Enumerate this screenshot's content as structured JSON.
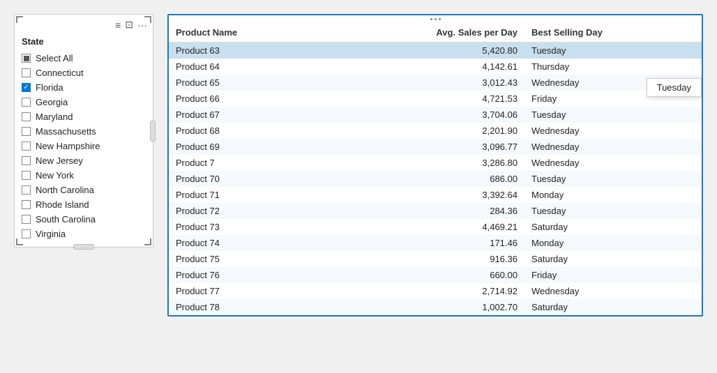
{
  "leftPanel": {
    "title": "State",
    "selectAllLabel": "Select All",
    "items": [
      {
        "label": "Connecticut",
        "checked": false
      },
      {
        "label": "Florida",
        "checked": true
      },
      {
        "label": "Georgia",
        "checked": false
      },
      {
        "label": "Maryland",
        "checked": false
      },
      {
        "label": "Massachusetts",
        "checked": false
      },
      {
        "label": "New Hampshire",
        "checked": false
      },
      {
        "label": "New Jersey",
        "checked": false
      },
      {
        "label": "New York",
        "checked": false
      },
      {
        "label": "North Carolina",
        "checked": false
      },
      {
        "label": "Rhode Island",
        "checked": false
      },
      {
        "label": "South Carolina",
        "checked": false
      },
      {
        "label": "Virginia",
        "checked": false
      }
    ]
  },
  "table": {
    "columns": [
      "Product Name",
      "Avg. Sales per Day",
      "Best Selling Day"
    ],
    "rows": [
      {
        "name": "Product 63",
        "avg": "5,420.80",
        "day": "Tuesday",
        "highlighted": true
      },
      {
        "name": "Product 64",
        "avg": "4,142.61",
        "day": "Thursday",
        "highlighted": false
      },
      {
        "name": "Product 65",
        "avg": "3,012.43",
        "day": "Wednesday",
        "highlighted": false
      },
      {
        "name": "Product 66",
        "avg": "4,721.53",
        "day": "Friday",
        "highlighted": false
      },
      {
        "name": "Product 67",
        "avg": "3,704.06",
        "day": "Tuesday",
        "highlighted": false
      },
      {
        "name": "Product 68",
        "avg": "2,201.90",
        "day": "Wednesday",
        "highlighted": false
      },
      {
        "name": "Product 69",
        "avg": "3,096.77",
        "day": "Wednesday",
        "highlighted": false
      },
      {
        "name": "Product 7",
        "avg": "3,286.80",
        "day": "Wednesday",
        "highlighted": false
      },
      {
        "name": "Product 70",
        "avg": "686.00",
        "day": "Tuesday",
        "highlighted": false
      },
      {
        "name": "Product 71",
        "avg": "3,392.64",
        "day": "Monday",
        "highlighted": false
      },
      {
        "name": "Product 72",
        "avg": "284.36",
        "day": "Tuesday",
        "highlighted": false
      },
      {
        "name": "Product 73",
        "avg": "4,469.21",
        "day": "Saturday",
        "highlighted": false
      },
      {
        "name": "Product 74",
        "avg": "171.46",
        "day": "Monday",
        "highlighted": false
      },
      {
        "name": "Product 75",
        "avg": "916.36",
        "day": "Saturday",
        "highlighted": false
      },
      {
        "name": "Product 76",
        "avg": "660.00",
        "day": "Friday",
        "highlighted": false
      },
      {
        "name": "Product 77",
        "avg": "2,714.92",
        "day": "Wednesday",
        "highlighted": false
      },
      {
        "name": "Product 78",
        "avg": "1,002.70",
        "day": "Saturday",
        "highlighted": false
      }
    ],
    "tooltip": "Tuesday"
  }
}
